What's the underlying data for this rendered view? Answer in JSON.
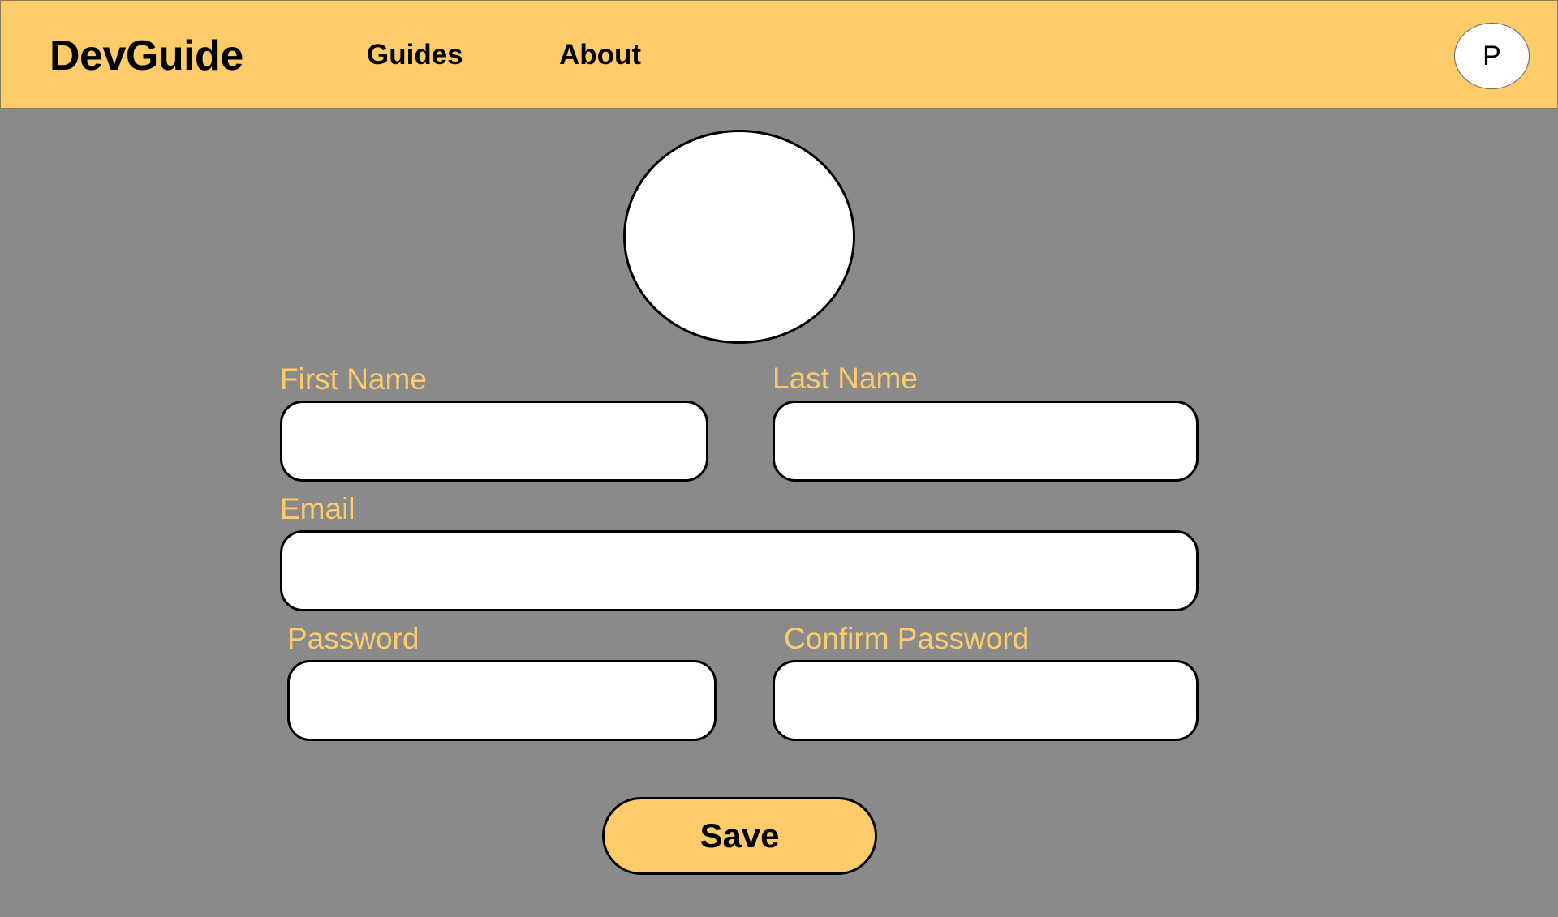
{
  "header": {
    "brand": "DevGuide",
    "nav": [
      {
        "label": "Guides"
      },
      {
        "label": "About"
      }
    ],
    "profile_initial": "P"
  },
  "form": {
    "first_name": {
      "label": "First Name",
      "value": ""
    },
    "last_name": {
      "label": "Last Name",
      "value": ""
    },
    "email": {
      "label": "Email",
      "value": ""
    },
    "password": {
      "label": "Password",
      "value": ""
    },
    "confirm_password": {
      "label": "Confirm Password",
      "value": ""
    },
    "save_label": "Save"
  },
  "colors": {
    "accent": "#fecb6a",
    "background": "#8a8a8a",
    "input_bg": "#ffffff"
  }
}
